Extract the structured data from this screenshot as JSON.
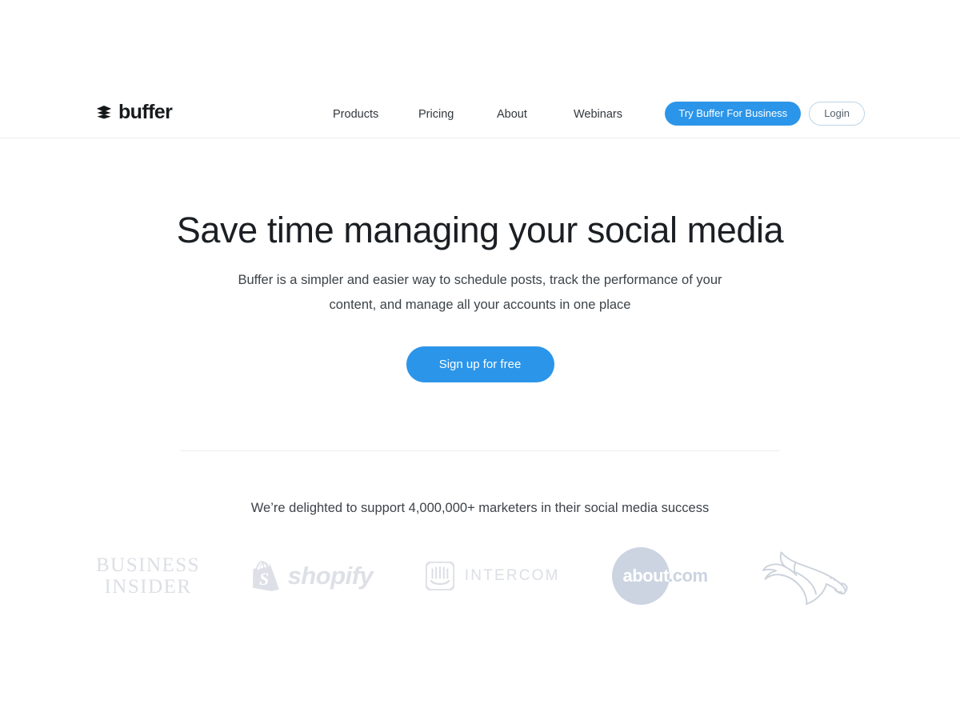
{
  "brand": {
    "name": "buffer",
    "icon": "stacked-layers-icon"
  },
  "nav": {
    "items": [
      {
        "label": "Products"
      },
      {
        "label": "Pricing"
      },
      {
        "label": "About"
      },
      {
        "label": "Webinars"
      }
    ]
  },
  "header_actions": {
    "business_cta": "Try Buffer For Business",
    "login": "Login"
  },
  "hero": {
    "title": "Save time managing your social media",
    "subtitle": "Buffer is a simpler and easier way to schedule posts, track the performance of your content, and manage all your accounts in one place",
    "cta": "Sign up for free"
  },
  "social_proof": {
    "text": "We’re delighted to support 4,000,000+ marketers in their social media success",
    "logos": [
      {
        "name": "Business Insider",
        "line1": "BUSINESS",
        "line2": "INSIDER"
      },
      {
        "name": "Shopify",
        "wordmark": "shopify"
      },
      {
        "name": "Intercom",
        "wordmark": "INTERCOM"
      },
      {
        "name": "About.com",
        "circle_text": "about",
        "suffix": ".com"
      },
      {
        "name": "Denver Broncos",
        "wordmark": ""
      }
    ]
  },
  "colors": {
    "accent_blue": "#2b95e9",
    "text_dark": "#1b1f23",
    "text_body": "#3d4348",
    "logo_grey": "#dcdfe4",
    "about_circle": "#ccd4e1",
    "border_light": "#eceef0",
    "login_border": "#bdd5e6"
  }
}
